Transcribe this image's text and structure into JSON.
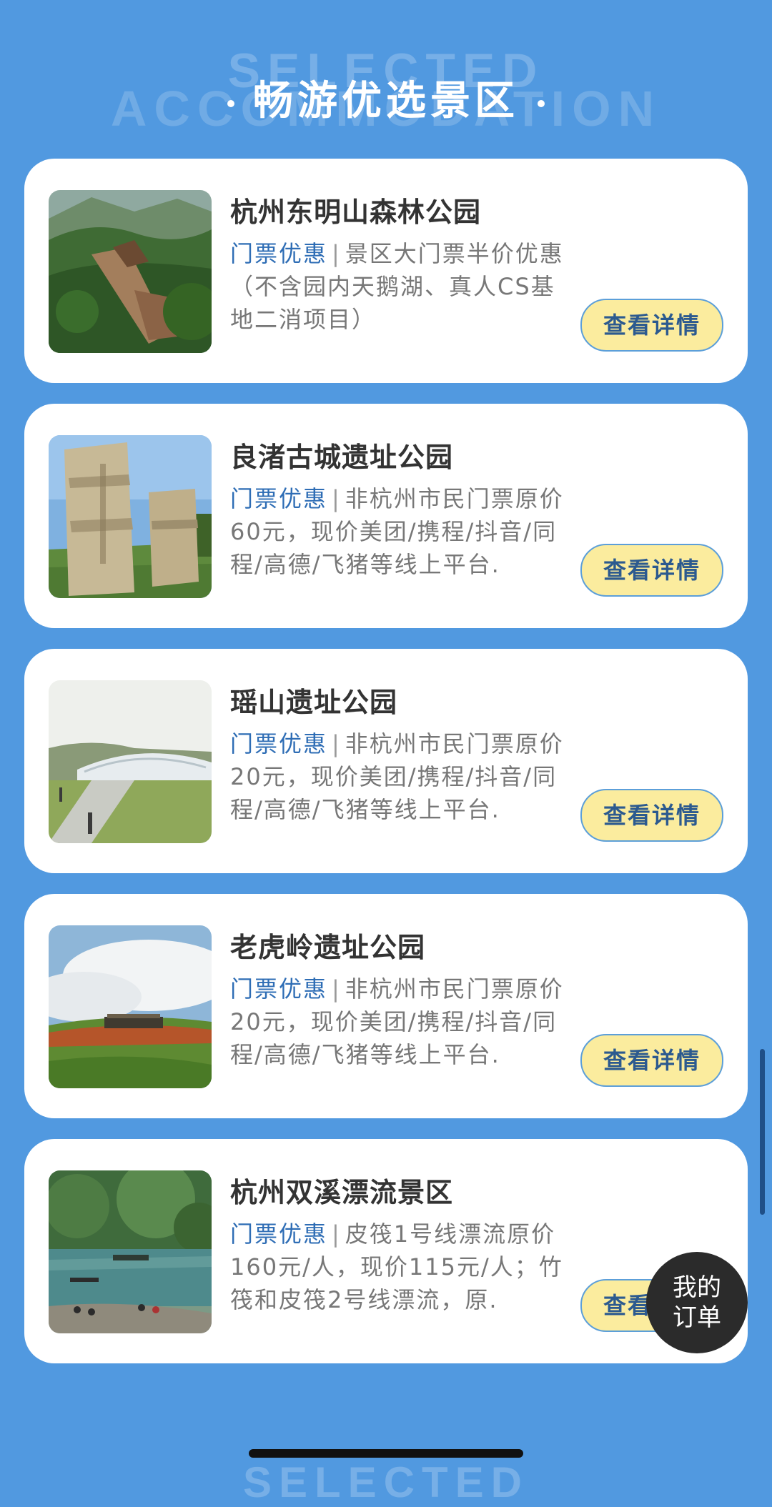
{
  "header": {
    "bg_word_1": "SELECTED",
    "bg_word_2": "ACCOMMODATION",
    "title": "畅游优选景区"
  },
  "cards": [
    {
      "title": "杭州东明山森林公园",
      "tag": "门票优惠",
      "desc": "景区大门票半价优惠（不含园内天鹅湖、真人CS基地二消项目）",
      "button": "查看详情",
      "image": "forest-temple-photo"
    },
    {
      "title": "良渚古城遗址公园",
      "tag": "门票优惠",
      "desc": "非杭州市民门票原价60元，现价美团/携程/抖音/同程/高德/飞猪等线上平台.",
      "button": "查看详情",
      "image": "stone-monument-photo"
    },
    {
      "title": "瑶山遗址公园",
      "tag": "门票优惠",
      "desc": "非杭州市民门票原价20元，现价美团/携程/抖音/同程/高德/飞猪等线上平台.",
      "button": "查看详情",
      "image": "dome-building-photo"
    },
    {
      "title": "老虎岭遗址公园",
      "tag": "门票优惠",
      "desc": "非杭州市民门票原价20元，现价美团/携程/抖音/同程/高德/飞猪等线上平台.",
      "button": "查看详情",
      "image": "hill-pavilion-photo"
    },
    {
      "title": "杭州双溪漂流景区",
      "tag": "门票优惠",
      "desc": "皮筏1号线漂流原价160元/人，现价115元/人；竹筏和皮筏2号线漂流，原.",
      "button": "查看详情",
      "image": "river-rafting-photo"
    }
  ],
  "float_button": {
    "line1": "我的",
    "line2": "订单"
  },
  "footer": {
    "bg_word": "SELECTED"
  }
}
